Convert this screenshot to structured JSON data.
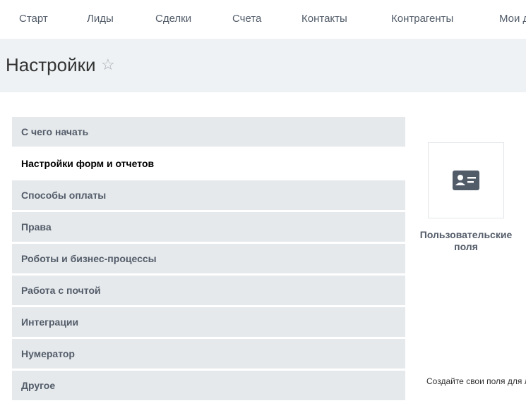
{
  "nav": {
    "items": [
      {
        "label": "Старт"
      },
      {
        "label": "Лиды"
      },
      {
        "label": "Сделки"
      },
      {
        "label": "Счета"
      },
      {
        "label": "Контакты"
      },
      {
        "label": "Контрагенты"
      },
      {
        "label": "Мои д"
      }
    ]
  },
  "page": {
    "title": "Настройки",
    "star_icon": "☆"
  },
  "menu": {
    "items": [
      {
        "label": "С чего начать",
        "active": false
      },
      {
        "label": "Настройки форм и отчетов",
        "active": true
      },
      {
        "label": "Способы оплаты",
        "active": false
      },
      {
        "label": "Права",
        "active": false
      },
      {
        "label": "Роботы и бизнес-процессы",
        "active": false
      },
      {
        "label": "Работа с почтой",
        "active": false
      },
      {
        "label": "Интеграции",
        "active": false
      },
      {
        "label": "Нумератор",
        "active": false
      },
      {
        "label": "Другое",
        "active": false
      }
    ]
  },
  "tiles": [
    {
      "label": "Пользовательские поля",
      "icon": "contact-card-icon"
    }
  ],
  "hint": "Создайте свои поля для л"
}
